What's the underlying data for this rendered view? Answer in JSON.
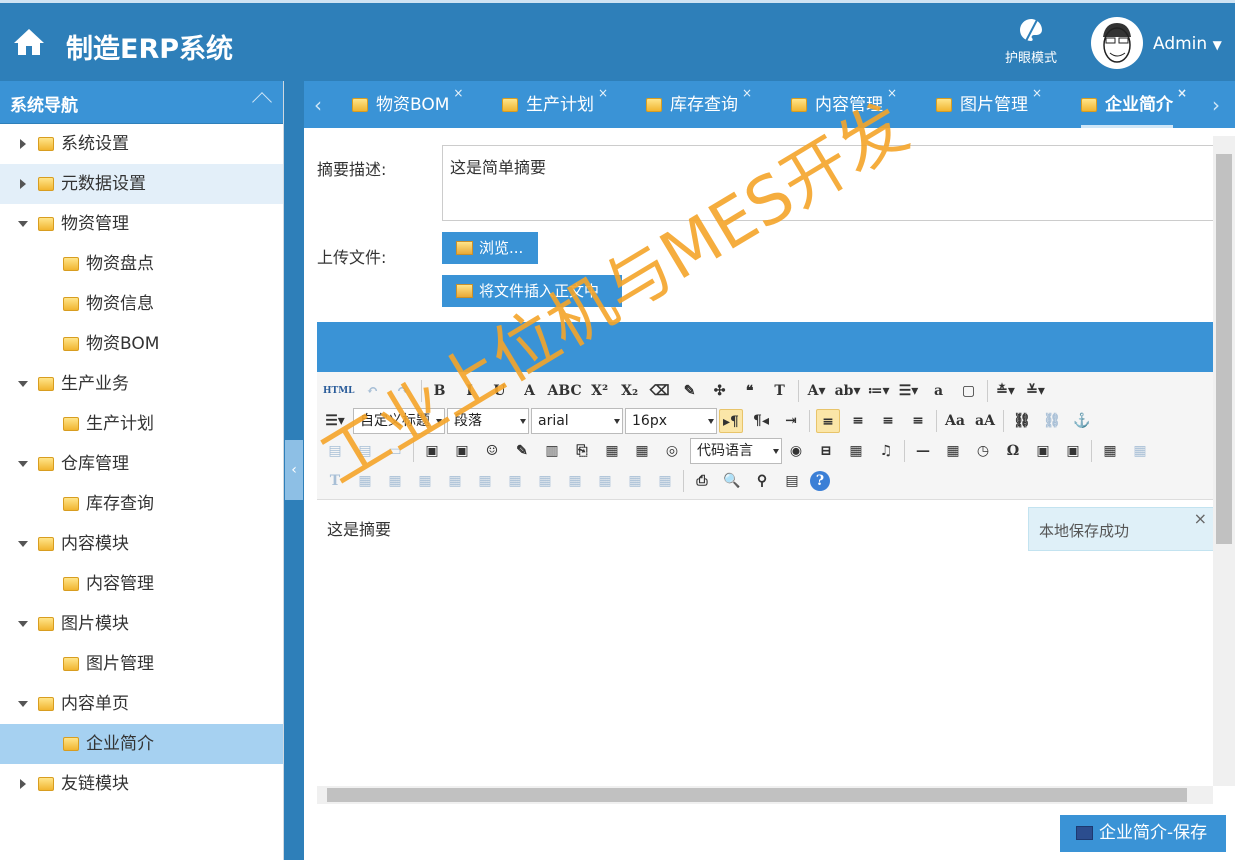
{
  "header": {
    "title": "制造ERP系统",
    "eye_mode": "护眼模式",
    "user": "Admin"
  },
  "sidebar": {
    "title": "系统导航",
    "items": [
      {
        "label": "系统设置",
        "level": 0,
        "arrow": "r",
        "state": ""
      },
      {
        "label": "元数据设置",
        "level": 0,
        "arrow": "r",
        "state": "hover"
      },
      {
        "label": "物资管理",
        "level": 0,
        "arrow": "d",
        "state": ""
      },
      {
        "label": "物资盘点",
        "level": 1,
        "state": ""
      },
      {
        "label": "物资信息",
        "level": 1,
        "state": ""
      },
      {
        "label": "物资BOM",
        "level": 1,
        "state": ""
      },
      {
        "label": "生产业务",
        "level": 0,
        "arrow": "d",
        "state": ""
      },
      {
        "label": "生产计划",
        "level": 1,
        "state": ""
      },
      {
        "label": "仓库管理",
        "level": 0,
        "arrow": "d",
        "state": ""
      },
      {
        "label": "库存查询",
        "level": 1,
        "state": ""
      },
      {
        "label": "内容模块",
        "level": 0,
        "arrow": "d",
        "state": ""
      },
      {
        "label": "内容管理",
        "level": 1,
        "state": ""
      },
      {
        "label": "图片模块",
        "level": 0,
        "arrow": "d",
        "state": ""
      },
      {
        "label": "图片管理",
        "level": 1,
        "state": ""
      },
      {
        "label": "内容单页",
        "level": 0,
        "arrow": "d",
        "state": ""
      },
      {
        "label": "企业简介",
        "level": 1,
        "state": "sel"
      },
      {
        "label": "友链模块",
        "level": 0,
        "arrow": "r",
        "state": ""
      }
    ]
  },
  "tabs": [
    {
      "label": "物资BOM"
    },
    {
      "label": "生产计划"
    },
    {
      "label": "库存查询"
    },
    {
      "label": "内容管理"
    },
    {
      "label": "图片管理"
    },
    {
      "label": "企业简介",
      "active": true
    }
  ],
  "tab_close": "×",
  "form": {
    "summary_label": "摘要描述:",
    "summary_value": "这是简单摘要",
    "upload_label": "上传文件:",
    "browse_button": "浏览...",
    "insert_button": "将文件插入正文中"
  },
  "toolbar": {
    "rows": [
      [
        [
          "html",
          "HTML"
        ],
        [
          "undo",
          "↶",
          1
        ],
        [
          "redo",
          "↷",
          1
        ],
        "|",
        [
          "bold",
          "B"
        ],
        [
          "italic",
          "I"
        ],
        [
          "underline",
          "U"
        ],
        [
          "font-border",
          "A"
        ],
        [
          "strikethrough",
          "ABC"
        ],
        [
          "superscript",
          "X²"
        ],
        [
          "subscript",
          "X₂"
        ],
        [
          "erase",
          "⌫"
        ],
        [
          "format-brush",
          "✎"
        ],
        [
          "auto-format",
          "✣"
        ],
        [
          "blockquote",
          "❝"
        ],
        [
          "paste-text",
          "T"
        ],
        "|",
        [
          "font-color",
          "A▾"
        ],
        [
          "background-color",
          "ab▾"
        ],
        [
          "ordered-list",
          "≔▾"
        ],
        [
          "unordered-list",
          "☰▾"
        ],
        [
          "select-all",
          "a"
        ],
        [
          "clear-doc",
          "▢"
        ],
        "|",
        [
          "row-spacing-top",
          "≛▾"
        ],
        [
          "row-spacing-bottom",
          "≚▾"
        ]
      ],
      [
        [
          "line-height",
          "☰▾"
        ],
        {
          "select": "自定义标题"
        },
        {
          "select": "段落"
        },
        {
          "select": "arial"
        },
        {
          "select": "16px"
        },
        [
          "ltr",
          "▸¶",
          0,
          1
        ],
        [
          "rtl",
          "¶◂"
        ],
        [
          "indent",
          "⇥"
        ],
        "|",
        [
          "align-left",
          "≡",
          0,
          1
        ],
        [
          "align-center",
          "≡"
        ],
        [
          "align-right",
          "≡"
        ],
        [
          "justify",
          "≡"
        ],
        "|",
        [
          "touppercase",
          "Aa"
        ],
        [
          "tolowercase",
          "aA"
        ],
        "|",
        [
          "link",
          "⛓"
        ],
        [
          "unlink",
          "⛓",
          1
        ],
        [
          "anchor",
          "⚓"
        ]
      ],
      [
        [
          "image-none",
          "▤",
          1
        ],
        [
          "image-left",
          "▤",
          1
        ],
        [
          "image-center",
          "▭",
          1
        ],
        "|",
        [
          "simple-upload",
          "▣"
        ],
        [
          "insert-image",
          "▣"
        ],
        [
          "emotion",
          "☺"
        ],
        [
          "scrawl",
          "✎"
        ],
        [
          "insert-video",
          "▥"
        ],
        [
          "attachment",
          "⎘"
        ],
        [
          "map",
          "▦"
        ],
        [
          "gmap",
          "▦"
        ],
        [
          "iframe",
          "◎"
        ],
        {
          "select": "代码语言"
        },
        [
          "page-break",
          "◉"
        ],
        [
          "template",
          "⊟"
        ],
        [
          "background",
          "▦"
        ],
        [
          "music",
          "♫"
        ],
        "|",
        [
          "horizontal",
          "—"
        ],
        [
          "date",
          "▦"
        ],
        [
          "time",
          "◷"
        ],
        [
          "special-chars",
          "Ω"
        ],
        [
          "snap",
          "▣"
        ],
        [
          "word-image",
          "▣"
        ],
        "|",
        [
          "insert-table",
          "▦"
        ],
        [
          "delete-table",
          "▦",
          1
        ]
      ],
      [
        [
          "insert-title",
          "T",
          1
        ],
        [
          "insert-row",
          "▦",
          1
        ],
        [
          "delete-row",
          "▦",
          1
        ],
        [
          "insert-col",
          "▦",
          1
        ],
        [
          "delete-col",
          "▦",
          1
        ],
        [
          "merge-cells",
          "▦",
          1
        ],
        [
          "merge-right",
          "▦",
          1
        ],
        [
          "merge-down",
          "▦",
          1
        ],
        [
          "split-cells",
          "▦",
          1
        ],
        [
          "split-rows",
          "▦",
          1
        ],
        [
          "split-cols",
          "▦",
          1
        ],
        [
          "chart",
          "▦",
          1
        ],
        "|",
        [
          "print",
          "⎙"
        ],
        [
          "preview",
          "🔍"
        ],
        [
          "search-replace",
          "⚲"
        ],
        [
          "drafts",
          "▤"
        ],
        [
          "help",
          "?"
        ]
      ]
    ]
  },
  "editor": {
    "content": "这是摘要"
  },
  "toast": {
    "message": "本地保存成功",
    "close": "×"
  },
  "save_button": "企业简介-保存",
  "watermark": "工业上位机与MES开发"
}
